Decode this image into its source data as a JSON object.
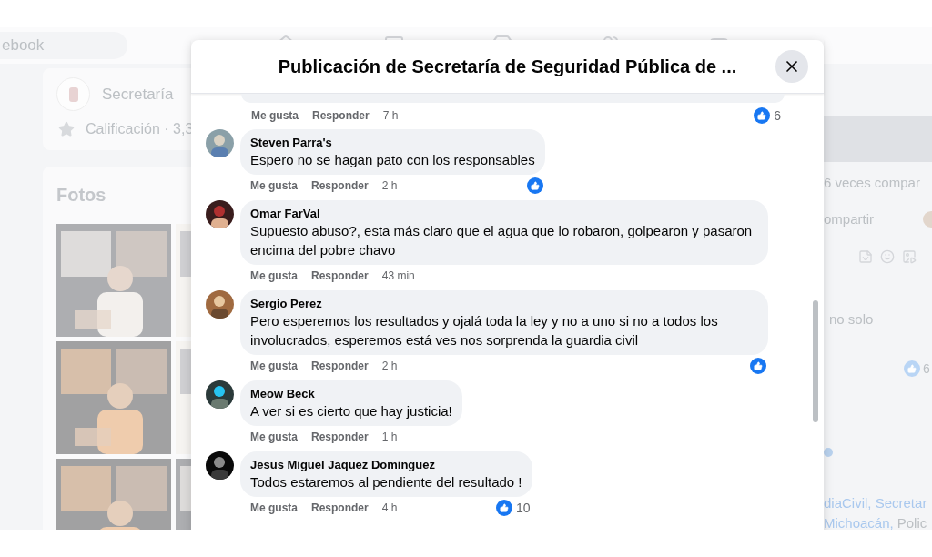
{
  "background": {
    "search_text": "ebook",
    "page_name": "Secretaría",
    "rating": "Calificación · 3,3",
    "photos_title": "Fotos",
    "right_panel": {
      "shares": "6 veces compar",
      "share_button": "ompartir",
      "post_text": "no solo",
      "reaction_count": "6",
      "tags_line_1": "diaCivil, Secretar",
      "tags_line_2_link": "Michoacán,",
      "tags_line_2_rest": "Polic"
    }
  },
  "modal": {
    "title": "Publicación de Secretaría de Seguridad Pública de ...",
    "previous_comment": {
      "like": "Me gusta",
      "reply": "Responder",
      "time": "7 h",
      "reacted": true,
      "reaction_count": "6"
    },
    "comments": [
      {
        "name": "Steven Parra's",
        "text": "Espero no se hagan pato con los responsables",
        "like": "Me gusta",
        "reply": "Responder",
        "time": "2 h",
        "reacted": true
      },
      {
        "name": "Omar FarVal",
        "text": "Supuesto abuso?, esta más claro que el agua que lo robaron, golpearon y pasaron encima del pobre chavo",
        "like": "Me gusta",
        "reply": "Responder",
        "time": "43 min",
        "reacted": false
      },
      {
        "name": "Sergio Perez",
        "text": "Pero esperemos los resultados y ojalá toda la ley y no a uno si no a todos los involucrados, esperemos está ves nos sorprenda la guardia civil",
        "like": "Me gusta",
        "reply": "Responder",
        "time": "2 h",
        "reacted": true
      },
      {
        "name": "Meow Beck",
        "text": "A ver si es cierto que hay justicia!",
        "like": "Me gusta",
        "reply": "Responder",
        "time": "1 h",
        "reacted": false
      },
      {
        "name": "Jesus Miguel Jaquez Dominguez",
        "text": "Todos estaremos al pendiente del resultado !",
        "like": "Me gusta",
        "reply": "Responder",
        "time": "4 h",
        "reacted": true,
        "reaction_count": "10"
      }
    ]
  }
}
